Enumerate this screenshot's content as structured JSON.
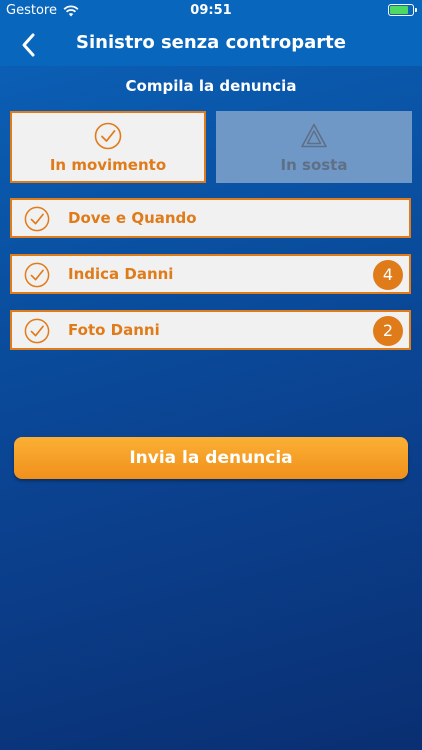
{
  "status_bar": {
    "carrier": "Gestore",
    "time": "09:51",
    "icons": [
      "wifi-icon",
      "battery-icon"
    ]
  },
  "nav": {
    "title": "Sinistro senza controparte",
    "back_icon": "chevron-left-icon"
  },
  "subtitle": "Compila la denuncia",
  "modes": [
    {
      "label": "In movimento",
      "icon": "check-circle-icon",
      "selected": true
    },
    {
      "label": "In sosta",
      "icon": "warning-triangle-icon",
      "selected": false
    }
  ],
  "steps": [
    {
      "label": "Dove e Quando",
      "icon": "check-circle-icon",
      "badge": ""
    },
    {
      "label": "Indica Danni",
      "icon": "check-circle-icon",
      "badge": "4"
    },
    {
      "label": "Foto Danni",
      "icon": "check-circle-icon",
      "badge": "2"
    }
  ],
  "submit_label": "Invia la denuncia",
  "colors": {
    "accent": "#e07b1a",
    "background": "#0a4fa0",
    "inactive_card": "#6f98c6"
  }
}
